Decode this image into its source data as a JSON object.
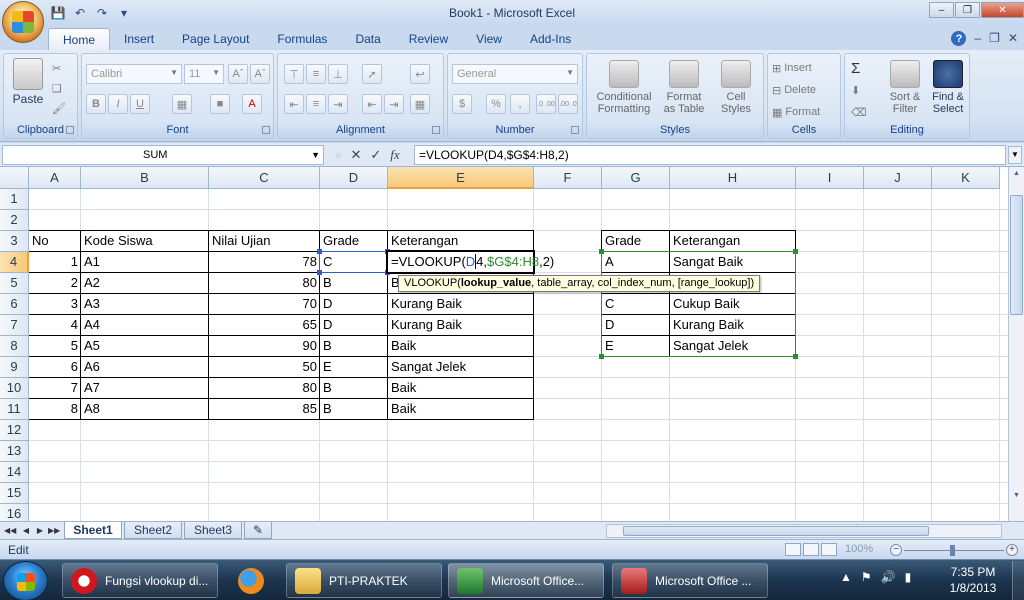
{
  "window": {
    "title": "Book1 - Microsoft Excel",
    "controls": [
      "minimize",
      "restore",
      "close"
    ]
  },
  "ribbon_tabs": [
    "Home",
    "Insert",
    "Page Layout",
    "Formulas",
    "Data",
    "Review",
    "View",
    "Add-Ins"
  ],
  "active_tab": "Home",
  "ribbon": {
    "clipboard": {
      "label": "Clipboard",
      "paste": "Paste"
    },
    "font": {
      "label": "Font",
      "font_name": "Calibri",
      "font_size": "11",
      "bold": "B",
      "italic": "I",
      "underline": "U"
    },
    "alignment": {
      "label": "Alignment"
    },
    "number": {
      "label": "Number",
      "format": "General",
      "currency": "$",
      "percent": "%",
      "comma": ",",
      "inc_decimal": ".0 .00",
      "dec_decimal": ".00 .0"
    },
    "styles": {
      "label": "Styles",
      "conditional": "Conditional\nFormatting",
      "format_table": "Format\nas Table",
      "cell_styles": "Cell\nStyles"
    },
    "cells": {
      "label": "Cells",
      "insert": "Insert",
      "delete": "Delete",
      "format": "Format"
    },
    "editing": {
      "label": "Editing",
      "sum": "Σ",
      "sort": "Sort &\nFilter",
      "find": "Find &\nSelect"
    }
  },
  "formula_bar": {
    "name_box": "SUM",
    "fx": "fx",
    "formula": "=VLOOKUP(D4,$G$4:H8,2)"
  },
  "columns": [
    "A",
    "B",
    "C",
    "D",
    "E",
    "F",
    "G",
    "H",
    "I",
    "J",
    "K"
  ],
  "selected_column": "E",
  "rows": [
    "1",
    "2",
    "3",
    "4",
    "5",
    "6",
    "7",
    "8",
    "9",
    "10",
    "11",
    "12",
    "13",
    "14",
    "15",
    "16"
  ],
  "selected_row": "4",
  "table1": {
    "headers": {
      "no": "No",
      "kode": "Kode Siswa",
      "nilai": "Nilai Ujian",
      "grade": "Grade",
      "ket": "Keterangan"
    },
    "rows": [
      {
        "no": "1",
        "kode": "A1",
        "nilai": "78",
        "grade": "C",
        "ket": ""
      },
      {
        "no": "2",
        "kode": "A2",
        "nilai": "80",
        "grade": "B",
        "ket": "B"
      },
      {
        "no": "3",
        "kode": "A3",
        "nilai": "70",
        "grade": "D",
        "ket": "Kurang Baik"
      },
      {
        "no": "4",
        "kode": "A4",
        "nilai": "65",
        "grade": "D",
        "ket": "Kurang Baik"
      },
      {
        "no": "5",
        "kode": "A5",
        "nilai": "90",
        "grade": "B",
        "ket": "Baik"
      },
      {
        "no": "6",
        "kode": "A6",
        "nilai": "50",
        "grade": "E",
        "ket": "Sangat Jelek"
      },
      {
        "no": "7",
        "kode": "A7",
        "nilai": "80",
        "grade": "B",
        "ket": "Baik"
      },
      {
        "no": "8",
        "kode": "A8",
        "nilai": "85",
        "grade": "B",
        "ket": "Baik"
      }
    ]
  },
  "editing_cell": {
    "part_fn": "=VLOOKUP(",
    "part_d": "D",
    "part_4": "4",
    "part_comma1": ",",
    "part_range": "$G$4:H8",
    "part_tail": ",2)"
  },
  "tooltip": {
    "fn": "VLOOKUP(",
    "arg1": "lookup_value",
    "rest": ", table_array, col_index_num, [range_lookup])"
  },
  "table2": {
    "headers": {
      "grade": "Grade",
      "ket": "Keterangan"
    },
    "rows": [
      {
        "grade": "A",
        "ket": "Sangat Baik"
      },
      {
        "grade": "",
        "ket": ""
      },
      {
        "grade": "C",
        "ket": "Cukup Baik"
      },
      {
        "grade": "D",
        "ket": "Kurang Baik"
      },
      {
        "grade": "E",
        "ket": "Sangat Jelek"
      }
    ]
  },
  "sheets": [
    "Sheet1",
    "Sheet2",
    "Sheet3"
  ],
  "active_sheet": "Sheet1",
  "status": {
    "mode": "Edit",
    "zoom": "100%"
  },
  "taskbar": {
    "items": [
      {
        "label": "Fungsi vlookup di...",
        "icon": "opera-icon"
      },
      {
        "label": "",
        "icon": "firefox-icon"
      },
      {
        "label": "PTI-PRAKTEK",
        "icon": "folder-icon"
      },
      {
        "label": "Microsoft Office...",
        "icon": "excel-icon"
      },
      {
        "label": "Microsoft Office ...",
        "icon": "access-icon"
      }
    ],
    "time": "7:35 PM",
    "date": "1/8/2013"
  },
  "colors": {
    "ribbon_text": "#15428b",
    "selection_header": "#f8c979",
    "range_blue": "#2b5bdb",
    "range_green": "#2e8b2e"
  }
}
